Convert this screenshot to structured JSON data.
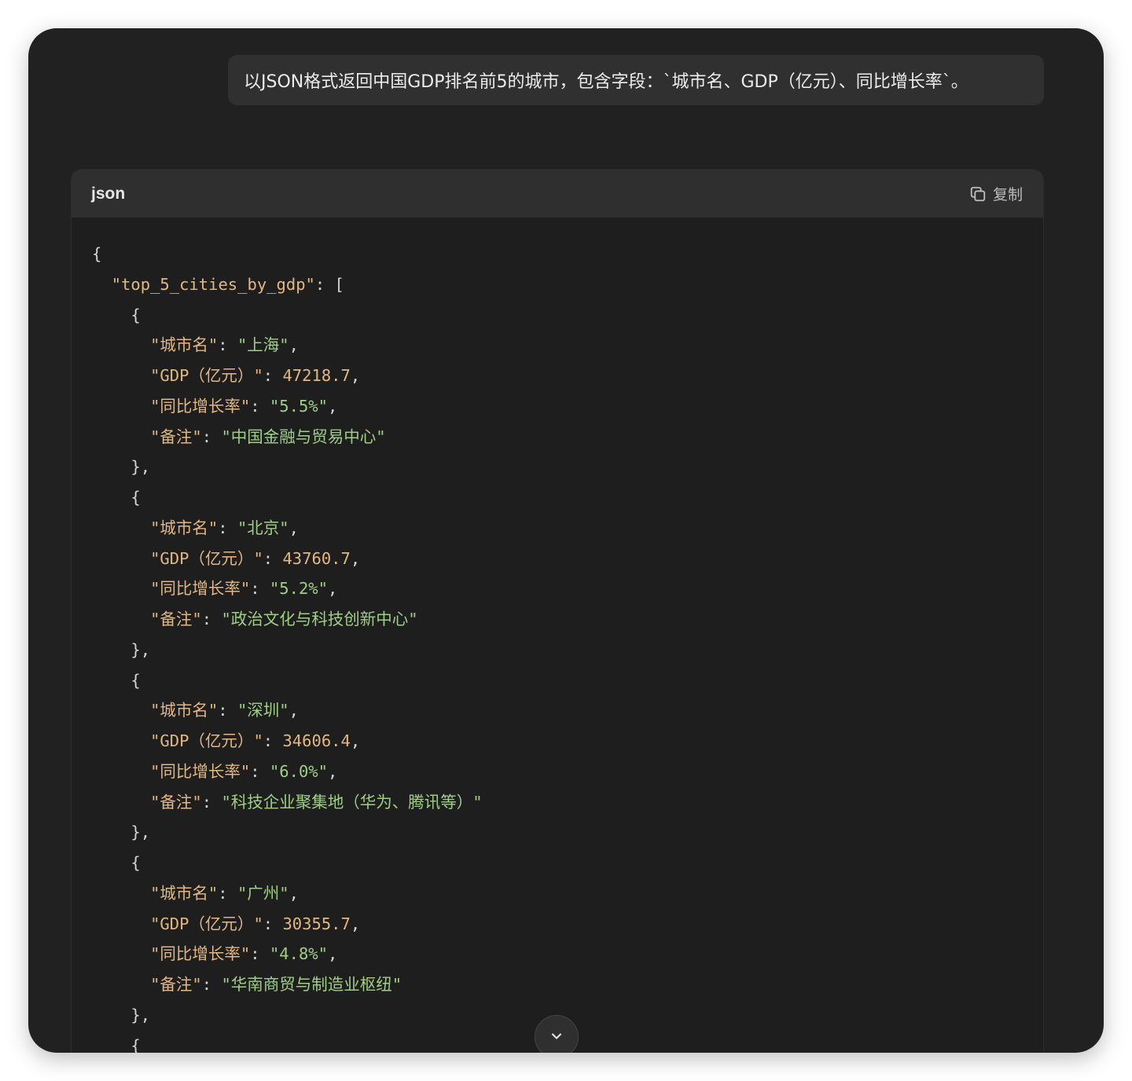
{
  "user_message": "以JSON格式返回中国GDP排名前5的城市，包含字段：`城市名、GDP（亿元）、同比增长率`。",
  "code_block": {
    "language": "json",
    "copy_label": "复制",
    "root_key": "top_5_cities_by_gdp",
    "field_labels": {
      "city": "城市名",
      "gdp": "GDP（亿元）",
      "growth": "同比增长率",
      "note": "备注"
    },
    "cities": [
      {
        "city": "上海",
        "gdp": "47218.7",
        "growth": "5.5%",
        "note": "中国金融与贸易中心"
      },
      {
        "city": "北京",
        "gdp": "43760.7",
        "growth": "5.2%",
        "note": "政治文化与科技创新中心"
      },
      {
        "city": "深圳",
        "gdp": "34606.4",
        "growth": "6.0%",
        "note": "科技企业聚集地（华为、腾讯等）"
      },
      {
        "city": "广州",
        "gdp": "30355.7",
        "growth": "4.8%",
        "note": "华南商贸与制造业枢纽"
      }
    ]
  },
  "icons": {
    "copy": "copy-icon",
    "scroll_down": "chevron-down-icon"
  }
}
